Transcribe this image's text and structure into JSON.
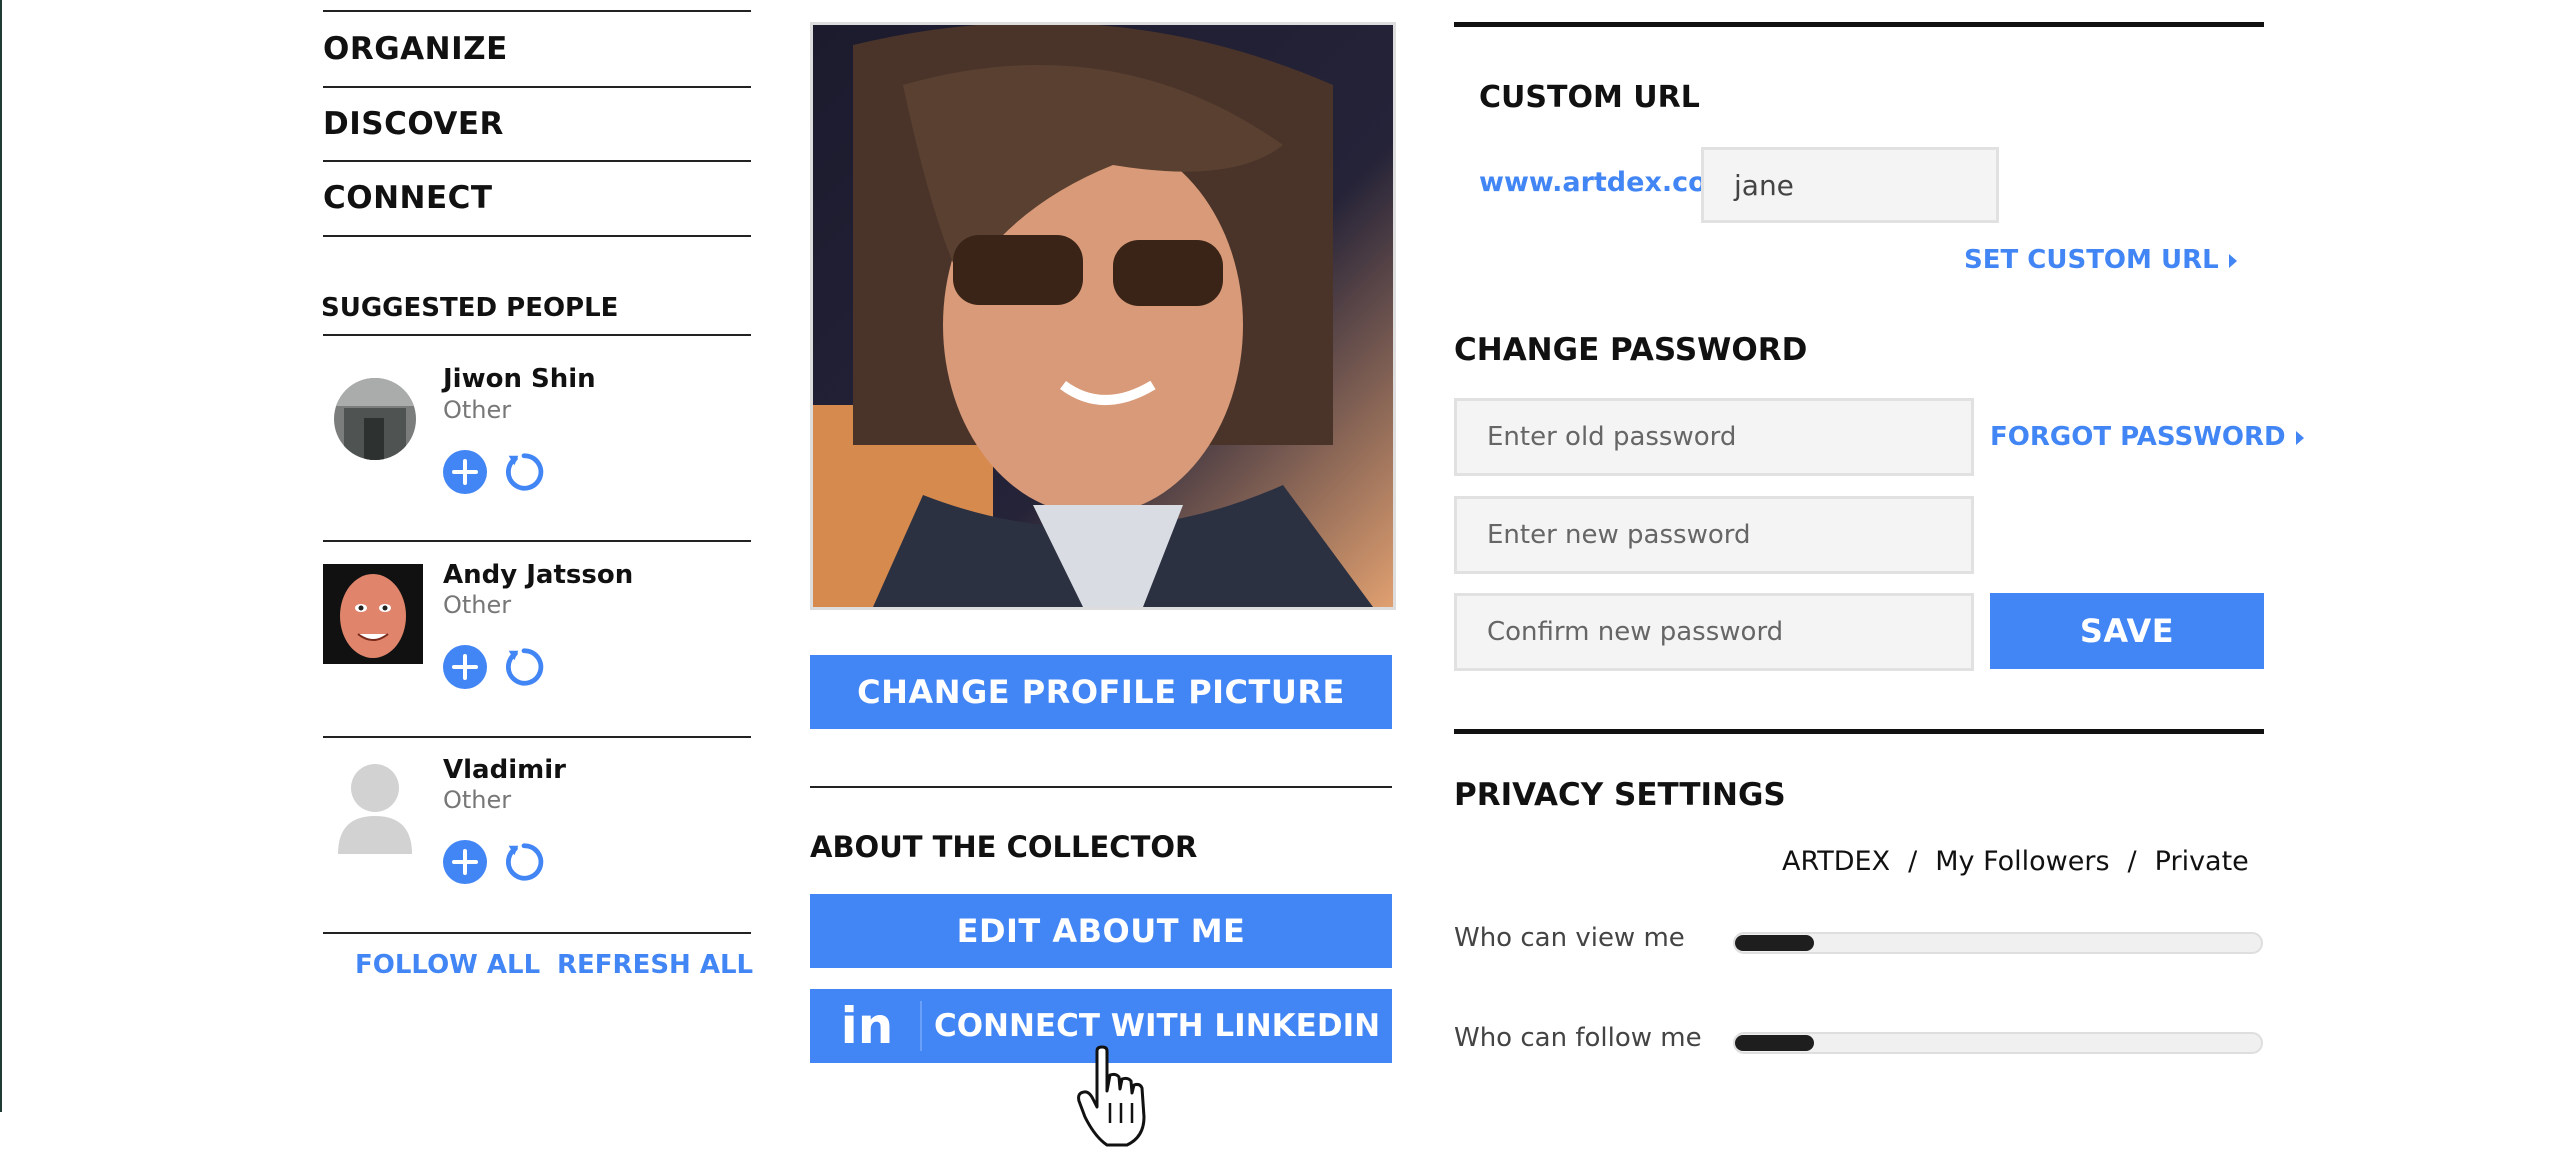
{
  "nav": {
    "items": [
      "ORGANIZE",
      "DISCOVER",
      "CONNECT"
    ]
  },
  "suggested": {
    "title": "SUGGESTED PEOPLE",
    "people": [
      {
        "name": "Jiwon Shin",
        "role": "Other",
        "follow_icon": "plus-icon",
        "refresh_icon": "refresh-icon"
      },
      {
        "name": "Andy Jatsson",
        "role": "Other",
        "follow_icon": "plus-icon",
        "refresh_icon": "refresh-icon"
      },
      {
        "name": "Vladimir",
        "role": "Other",
        "follow_icon": "plus-icon",
        "refresh_icon": "refresh-icon"
      }
    ],
    "follow_all": "FOLLOW ALL",
    "refresh_all": "REFRESH ALL"
  },
  "profile": {
    "change_picture": "CHANGE PROFILE PICTURE",
    "about_title": "ABOUT THE COLLECTOR",
    "edit_about": "EDIT ABOUT ME",
    "linkedin_icon_text": "in",
    "connect_linkedin": "CONNECT WITH LINKEDIN"
  },
  "custom_url": {
    "title": "CUSTOM URL",
    "prefix": "www.artdex.com/",
    "value": "jane",
    "set_link": "SET CUSTOM URL"
  },
  "password": {
    "title": "CHANGE PASSWORD",
    "old_placeholder": "Enter old password",
    "new_placeholder": "Enter new password",
    "confirm_placeholder": "Confirm new password",
    "forgot_link": "FORGOT PASSWORD",
    "save": "SAVE"
  },
  "privacy": {
    "title": "PRIVACY SETTINGS",
    "scale": {
      "artdex": "ARTDEX",
      "sep": "/",
      "followers": "My Followers",
      "private": "Private"
    },
    "rows": [
      {
        "label": "Who can view me",
        "level": 0.15
      },
      {
        "label": "Who can follow me",
        "level": 0.15
      }
    ]
  },
  "colors": {
    "accent": "#4285f4",
    "text": "#111111",
    "slider_fill": "#1e1e1e"
  }
}
